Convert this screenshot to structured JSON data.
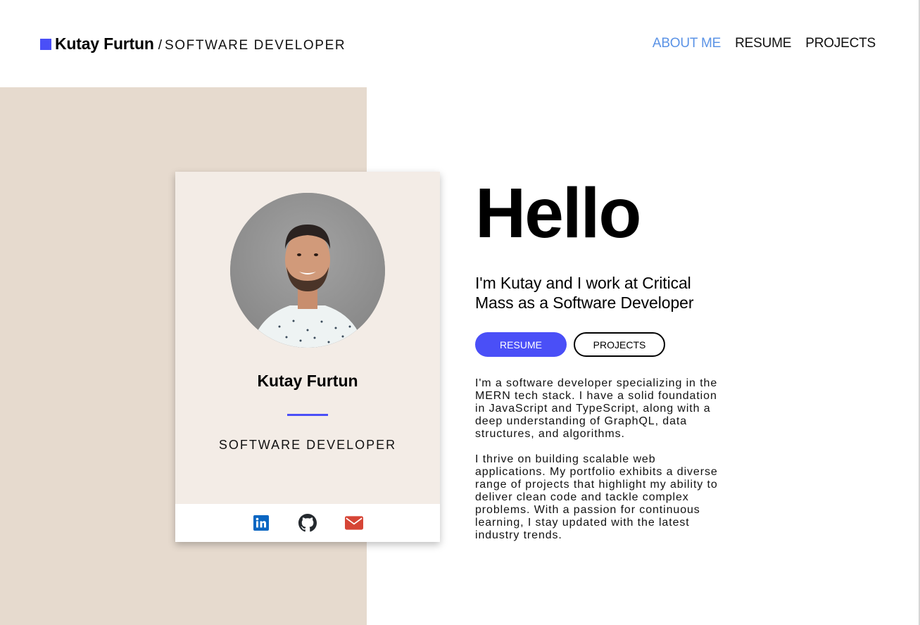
{
  "header": {
    "brand_name": "Kutay Furtun",
    "brand_separator": "/",
    "brand_role": "SOFTWARE DEVELOPER",
    "nav": [
      {
        "label": "ABOUT ME",
        "active": true
      },
      {
        "label": "RESUME",
        "active": false
      },
      {
        "label": "PROJECTS",
        "active": false
      }
    ]
  },
  "card": {
    "avatar_alt": "Profile photo of Kutay Furtun",
    "name": "Kutay Furtun",
    "role": "SOFTWARE DEVELOPER",
    "social": [
      {
        "icon": "linkedin-icon",
        "color": "#0a66c2"
      },
      {
        "icon": "github-icon",
        "color": "#24292e"
      },
      {
        "icon": "email-icon",
        "color": "#d64536"
      }
    ]
  },
  "main": {
    "greeting": "Hello",
    "intro": "I'm Kutay and I work at Critical Mass as a Software Developer",
    "buttons": {
      "resume": "RESUME",
      "projects": "PROJECTS"
    },
    "bio": [
      "I'm a software developer specializing in the MERN tech stack. I have a solid foundation in JavaScript and TypeScript, along with a deep understanding of GraphQL, data structures, and algorithms.",
      "I thrive on building scalable web applications. My portfolio exhibits a diverse range of projects that highlight my ability to deliver clean code and tackle complex problems. With a passion for continuous learning, I stay updated with the latest industry trends."
    ]
  },
  "colors": {
    "accent": "#4a4ff7",
    "nav_active": "#5b93e6",
    "panel_bg": "#e6dace",
    "card_bg": "#f3ece6"
  }
}
